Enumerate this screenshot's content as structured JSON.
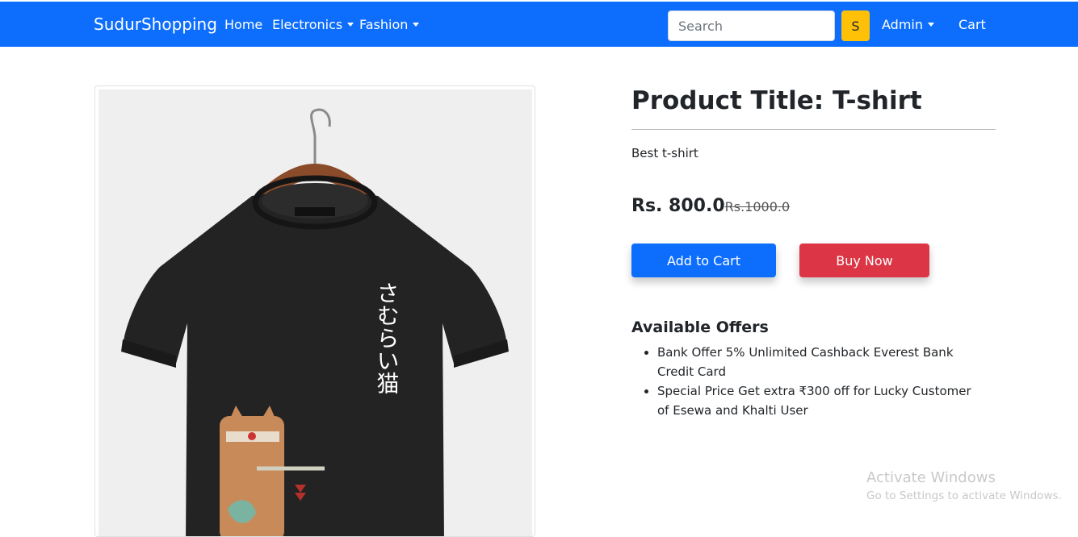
{
  "navbar": {
    "brand": "SudurShopping",
    "links": [
      {
        "label": "Home"
      },
      {
        "label": "Electronics"
      },
      {
        "label": "Fashion"
      }
    ],
    "search_placeholder": "Search",
    "search_button": "S",
    "admin_label": "Admin",
    "cart_label": "Cart",
    "bg_color": "#0d6efd"
  },
  "product": {
    "image_text": "さむらい猫",
    "title": "Product Title: T-shirt",
    "description": "Best t-shirt",
    "price": "Rs. 800.0",
    "old_price": "Rs.1000.0",
    "add_to_cart": "Add to Cart",
    "buy_now": "Buy Now"
  },
  "offers": {
    "title": "Available Offers",
    "items": [
      "Bank Offer 5% Unlimited Cashback Everest Bank Credit Card",
      "Special Price Get extra ₹300 off for Lucky Customer of Esewa and Khalti User"
    ]
  },
  "watermark": {
    "title": "Activate Windows",
    "subtitle": "Go to Settings to activate Windows."
  }
}
